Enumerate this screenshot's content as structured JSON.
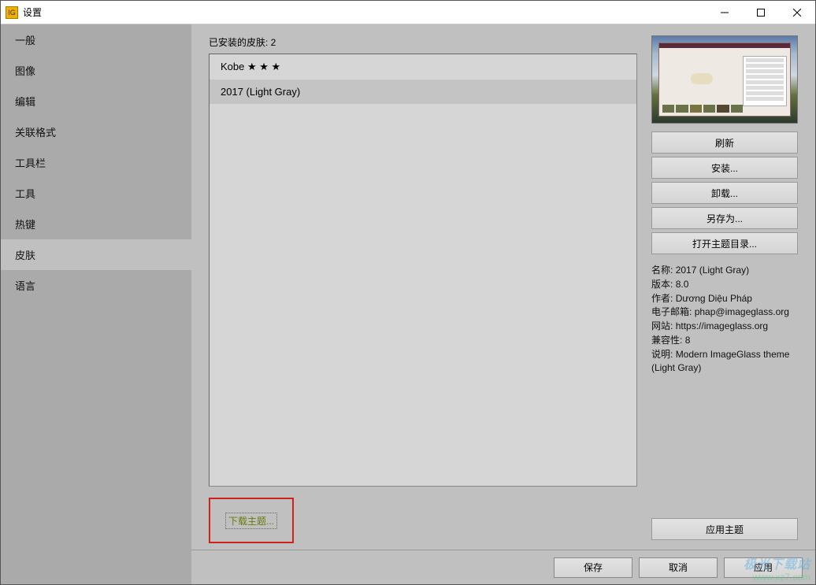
{
  "window": {
    "title": "设置"
  },
  "sidebar": {
    "items": [
      {
        "label": "一般"
      },
      {
        "label": "图像"
      },
      {
        "label": "编辑"
      },
      {
        "label": "关联格式"
      },
      {
        "label": "工具栏"
      },
      {
        "label": "工具"
      },
      {
        "label": "热键"
      },
      {
        "label": "皮肤"
      },
      {
        "label": "语言"
      }
    ],
    "active_index": 7
  },
  "skins": {
    "label": "已安装的皮肤: 2",
    "items": [
      {
        "name": "Kobe ★ ★ ★"
      },
      {
        "name": "2017 (Light Gray)"
      }
    ],
    "selected_index": 1,
    "download_link": "下载主题..."
  },
  "actions": {
    "refresh": "刷新",
    "install": "安装...",
    "uninstall": "卸载...",
    "saveas": "另存为...",
    "open_dir": "打开主题目录...",
    "apply_theme": "应用主题"
  },
  "info": {
    "name_label": "名称:",
    "name": "2017 (Light Gray)",
    "version_label": "版本:",
    "version": "8.0",
    "author_label": "作者:",
    "author": "Dương Diệu Pháp",
    "email_label": "电子邮箱:",
    "email": "phap@imageglass.org",
    "website_label": "网站:",
    "website": "https://imageglass.org",
    "compat_label": "兼容性:",
    "compat": "8",
    "desc_label": "说明:",
    "desc": "Modern ImageGlass theme (Light Gray)"
  },
  "footer": {
    "save": "保存",
    "cancel": "取消",
    "apply": "应用"
  },
  "watermark": {
    "line1": "极光下载站",
    "line2": "www.xz7.com"
  }
}
